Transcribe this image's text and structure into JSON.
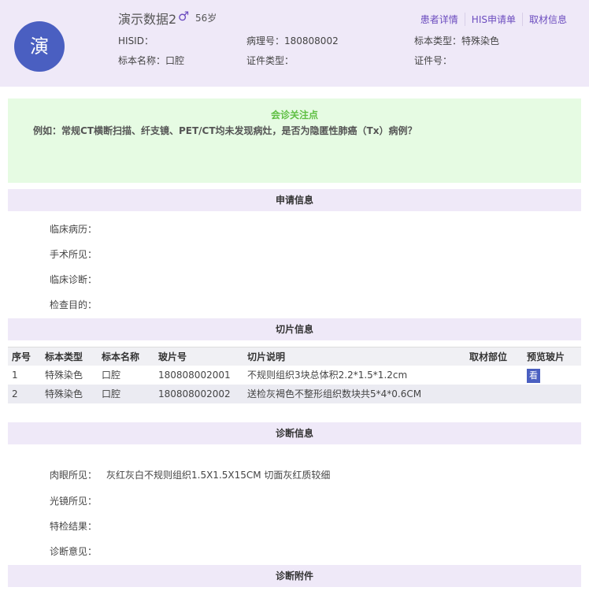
{
  "patient": {
    "avatar_char": "演",
    "name": "演示数据2",
    "gender_symbol": "♂",
    "age": "56岁"
  },
  "header_links": [
    "患者详情",
    "HIS申请单",
    "取材信息"
  ],
  "info": {
    "hisid_label": "HISID：",
    "pathology_no": "病理号：180808002",
    "specimen_type": "标本类型：特殊染色",
    "specimen_name": "标本名称：口腔",
    "id_type": "证件类型：",
    "id_no": "证件号："
  },
  "notice": {
    "title": "会诊关注点",
    "text": "例如：常规CT横断扫描、纤支镜、PET/CT均未发现病灶，是否为隐匿性肺癌（Tx）病例？"
  },
  "sections": {
    "apply": "申请信息",
    "slides": "切片信息",
    "diagnosis": "诊断信息",
    "attachment": "诊断附件"
  },
  "apply_fields": [
    "临床病历：",
    "手术所见：",
    "临床诊断：",
    "检查目的："
  ],
  "slide_table": {
    "columns": [
      "序号",
      "标本类型",
      "标本名称",
      "玻片号",
      "切片说明",
      "取材部位",
      "预览玻片"
    ],
    "rows": [
      [
        "1",
        "特殊染色",
        "口腔",
        "180808002001",
        "不规则组织3块总体积2.2*1.5*1.2cm",
        "",
        "看"
      ],
      [
        "2",
        "特殊染色",
        "口腔",
        "180808002002",
        "送检灰褐色不整形组织数块共5*4*0.6CM",
        "",
        ""
      ]
    ]
  },
  "diagnosis_fields": [
    {
      "label": "肉眼所见：",
      "value": "灰红灰白不规则组织1.5X1.5X15CM 切面灰红质较细"
    },
    {
      "label": "光镜所见：",
      "value": ""
    },
    {
      "label": "特检结果：",
      "value": ""
    },
    {
      "label": "诊断意见：",
      "value": ""
    }
  ],
  "colors": {
    "accent": "#4a5fc1",
    "link": "#6c4dbf",
    "notice_title": "#5fbf43",
    "header_bg": "#efe9f8",
    "notice_bg": "#e6fbe3"
  }
}
